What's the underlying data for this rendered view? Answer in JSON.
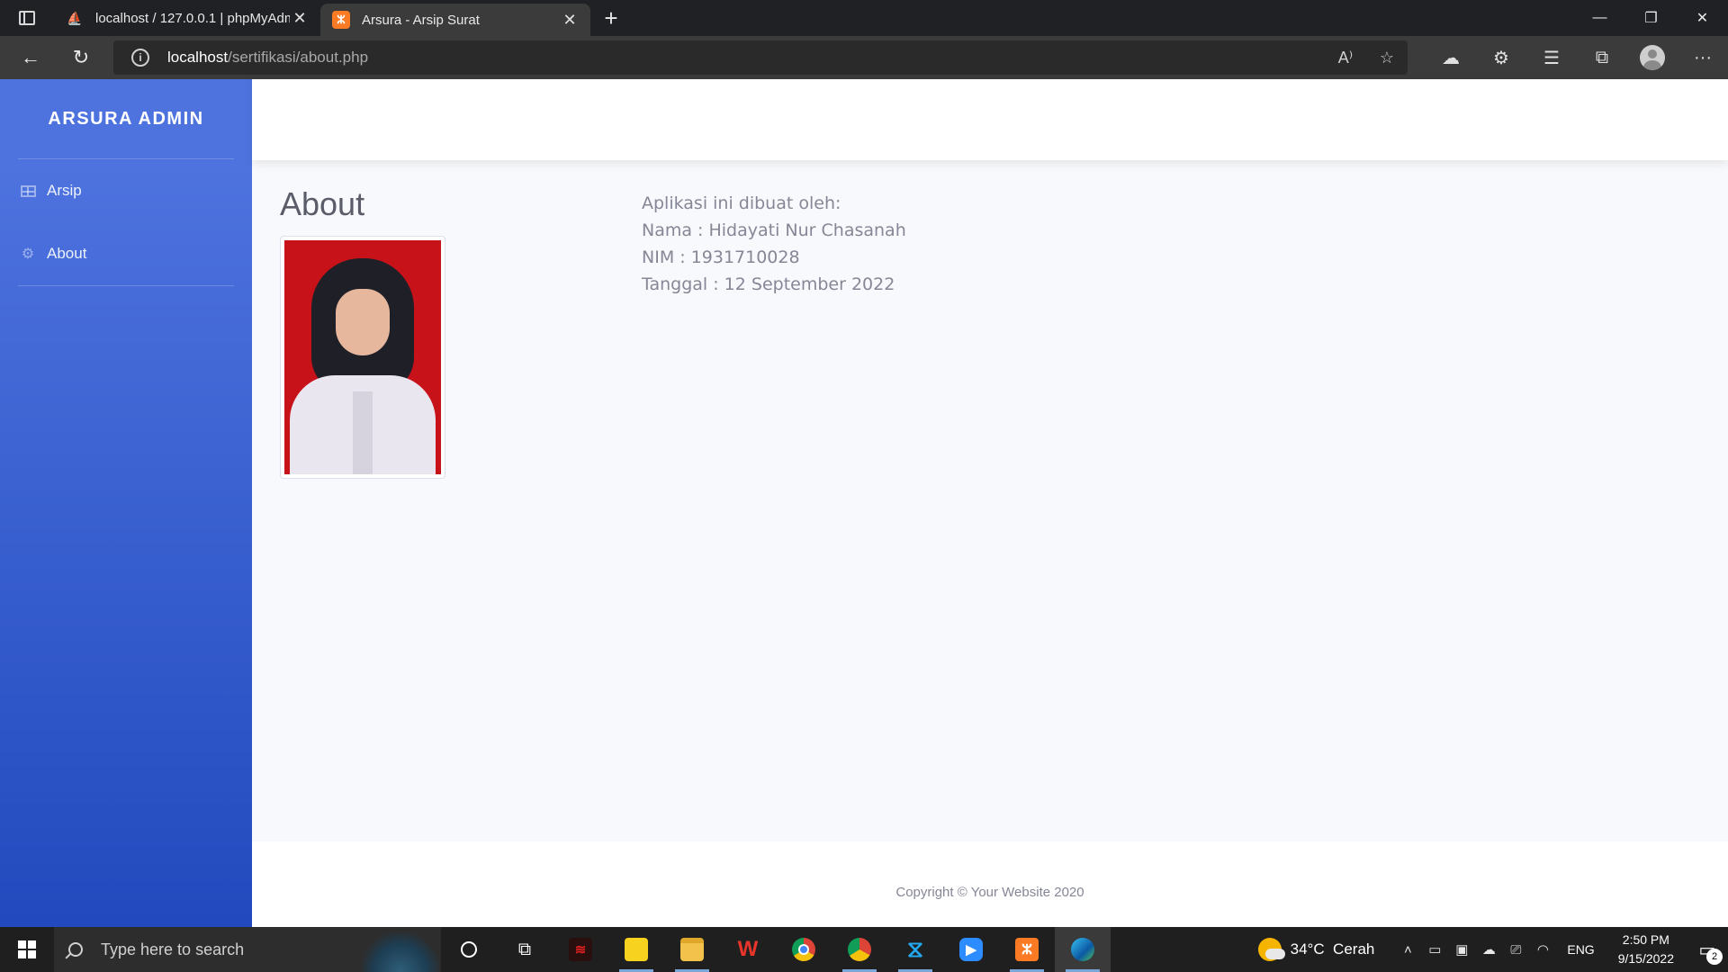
{
  "browser": {
    "tabs": [
      {
        "title": "localhost / 127.0.0.1 | phpMyAdmin",
        "active": false,
        "favicon": "phpmyadmin-icon"
      },
      {
        "title": "Arsura - Arsip Surat",
        "active": true,
        "favicon": "xampp-icon"
      }
    ],
    "url_host": "localhost",
    "url_path": "/sertifikasi/about.php"
  },
  "sidebar": {
    "brand": "ARSURA ADMIN",
    "items": [
      {
        "label": "Arsip",
        "icon": "table-icon"
      },
      {
        "label": "About",
        "icon": "gear-icon"
      }
    ]
  },
  "page": {
    "title": "About",
    "info": {
      "line1": "Aplikasi ini dibuat oleh:",
      "line2": "Nama : Hidayati Nur Chasanah",
      "line3": "NIM : 1931710028",
      "line4": "Tanggal : 12 September 2022"
    },
    "footer": "Copyright © Your Website 2020"
  },
  "taskbar": {
    "search_placeholder": "Type here to search",
    "weather": "34°C  Cerah",
    "lang": "ENG",
    "time": "2:50 PM",
    "date": "9/15/2022",
    "notifications": "2"
  },
  "colors": {
    "sidebar_top": "#4e73df",
    "sidebar_bottom": "#224abe",
    "content_bg": "#f8f9fc",
    "text_muted": "#858796"
  }
}
